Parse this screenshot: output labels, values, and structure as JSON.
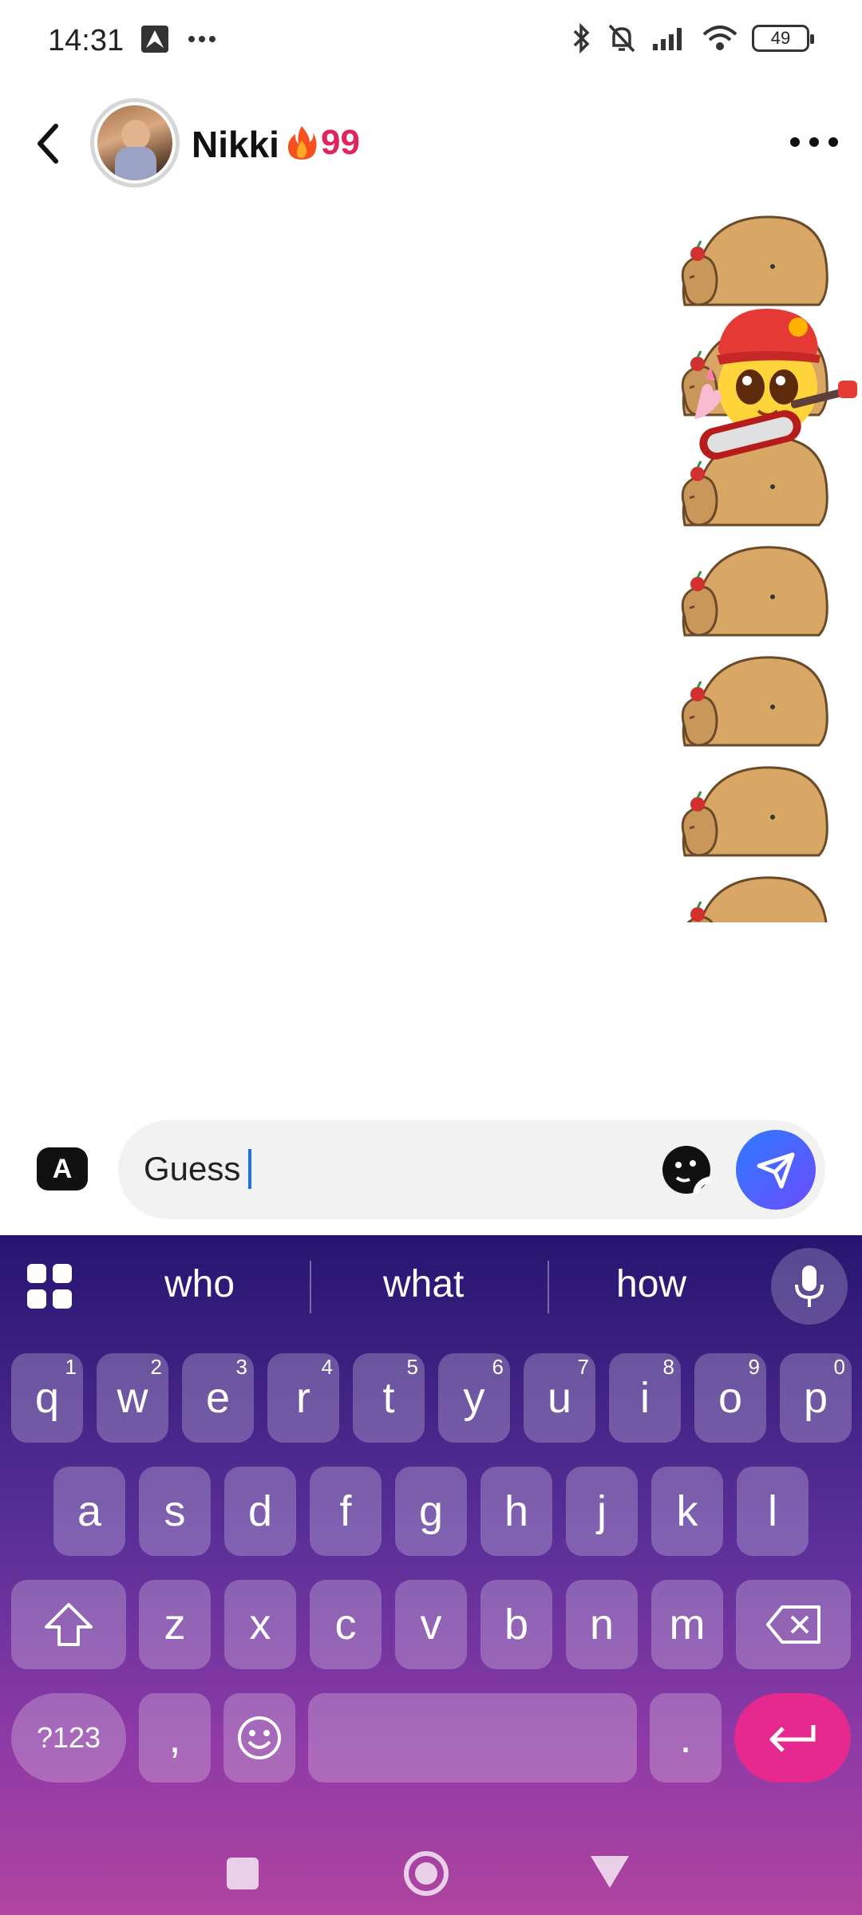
{
  "status_bar": {
    "time": "14:31",
    "left_icons": [
      "nav-app-icon",
      "more-dots-icon"
    ],
    "right_icons": [
      "bluetooth-icon",
      "bell-muted-icon",
      "signal-icon",
      "wifi-icon"
    ],
    "battery": "49"
  },
  "header": {
    "name": "Nikki",
    "streak_icon": "fire-icon",
    "streak_count": "99"
  },
  "chat": {
    "stickers": [
      "capybara-sticker",
      "capybara-sticker",
      "capybara-sticker",
      "capybara-sticker",
      "capybara-sticker",
      "capybara-sticker",
      "capybara-sticker"
    ],
    "overlay_sticker": "rocker-emoji-guitar-sticker"
  },
  "composer": {
    "app_button_label": "A",
    "text": "Guess"
  },
  "keyboard": {
    "suggestions": [
      "who",
      "what",
      "how"
    ],
    "row1": [
      {
        "k": "q",
        "h": "1"
      },
      {
        "k": "w",
        "h": "2"
      },
      {
        "k": "e",
        "h": "3"
      },
      {
        "k": "r",
        "h": "4"
      },
      {
        "k": "t",
        "h": "5"
      },
      {
        "k": "y",
        "h": "6"
      },
      {
        "k": "u",
        "h": "7"
      },
      {
        "k": "i",
        "h": "8"
      },
      {
        "k": "o",
        "h": "9"
      },
      {
        "k": "p",
        "h": "0"
      }
    ],
    "row2": [
      "a",
      "s",
      "d",
      "f",
      "g",
      "h",
      "j",
      "k",
      "l"
    ],
    "row3": [
      "z",
      "x",
      "c",
      "v",
      "b",
      "n",
      "m"
    ],
    "symbols_label": "?123",
    "comma_label": ",",
    "period_label": "."
  },
  "colors": {
    "streak": "#e0245e",
    "send_button": "#4a63ff",
    "enter_key": "#e5298e",
    "caret": "#1a73e8"
  }
}
